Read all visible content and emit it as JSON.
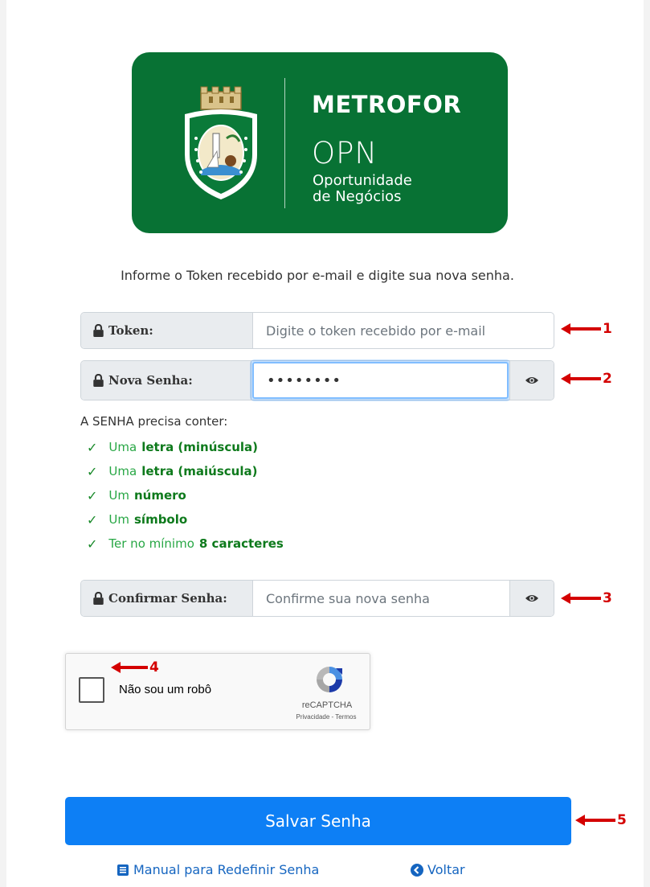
{
  "logo": {
    "title": "METROFOR",
    "abbr": "OPN",
    "subtitle_line1": "Oportunidade",
    "subtitle_line2": "de Negócios",
    "brand_color": "#087234"
  },
  "instructions": "Informe o Token recebido por e-mail e digite sua nova senha.",
  "form": {
    "token": {
      "label": "Token:",
      "placeholder": "Digite o token recebido por e-mail",
      "value": ""
    },
    "new_password": {
      "label": "Nova Senha:",
      "value": "••••••••"
    },
    "confirm_password": {
      "label": "Confirmar Senha:",
      "placeholder": "Confirme sua nova senha",
      "value": ""
    }
  },
  "requirements": {
    "title": "A SENHA precisa conter:",
    "items": [
      {
        "check": "✓",
        "prefix": "Uma",
        "highlight": "letra (minúscula)"
      },
      {
        "check": "✓",
        "prefix": "Uma",
        "highlight": "letra (maiúscula)"
      },
      {
        "check": "✓",
        "prefix": "Um",
        "highlight": "número"
      },
      {
        "check": "✓",
        "prefix": "Um",
        "highlight": "símbolo"
      },
      {
        "check": "✓",
        "prefix": "Ter no mínimo",
        "highlight": "8 caracteres"
      }
    ]
  },
  "captcha": {
    "label": "Não sou um robô",
    "brand": "reCAPTCHA",
    "links": "Privacidade - Termos"
  },
  "save_button": "Salvar Senha",
  "footer": {
    "manual_link": "Manual para Redefinir Senha",
    "back_link": "Voltar"
  },
  "annotations": [
    "1",
    "2",
    "3",
    "4",
    "5"
  ],
  "colors": {
    "primary": "#0d7ff5",
    "success": "#28a745",
    "annotation": "#d40000"
  }
}
